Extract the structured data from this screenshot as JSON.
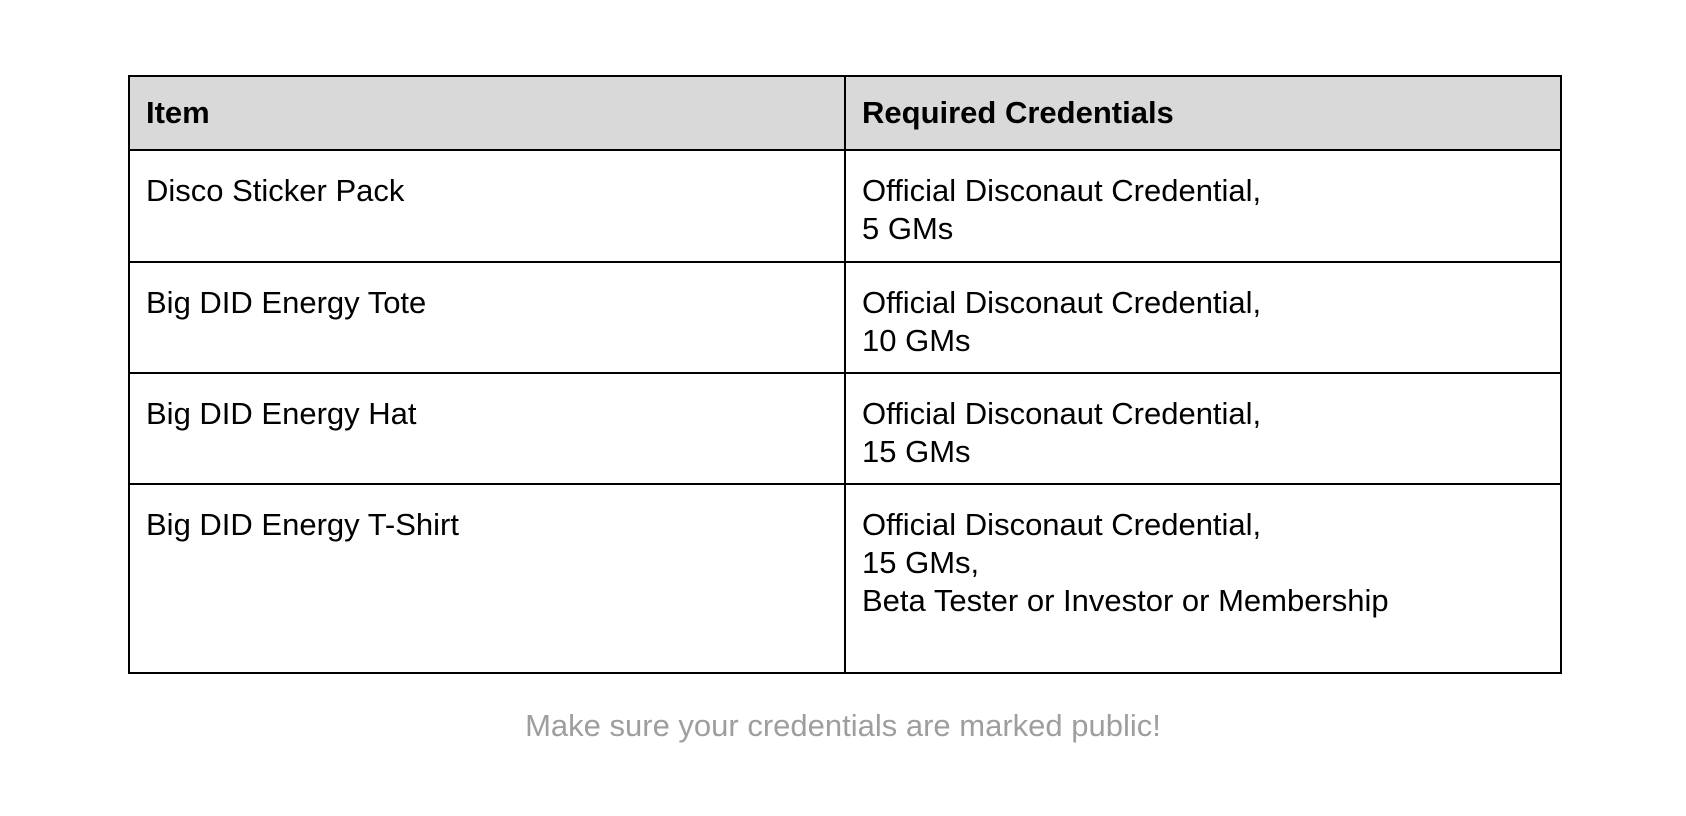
{
  "table": {
    "headers": [
      "Item",
      "Required Credentials"
    ],
    "rows": [
      {
        "item": "Disco Sticker Pack",
        "credentials": [
          "Official Disconaut Credential,",
          "5 GMs"
        ]
      },
      {
        "item": "Big DID Energy Tote",
        "credentials": [
          "Official Disconaut Credential,",
          "10 GMs"
        ]
      },
      {
        "item": "Big DID Energy Hat",
        "credentials": [
          "Official Disconaut Credential,",
          "15 GMs"
        ]
      },
      {
        "item": "Big DID Energy T-Shirt",
        "credentials": [
          "Official Disconaut Credential,",
          "15 GMs,",
          "Beta Tester or Investor or Membership"
        ]
      }
    ]
  },
  "note": "Make sure your credentials are marked public!",
  "colors": {
    "header_bg": "#d9d9d9",
    "border": "#000000",
    "note_text": "#9e9e9e"
  }
}
